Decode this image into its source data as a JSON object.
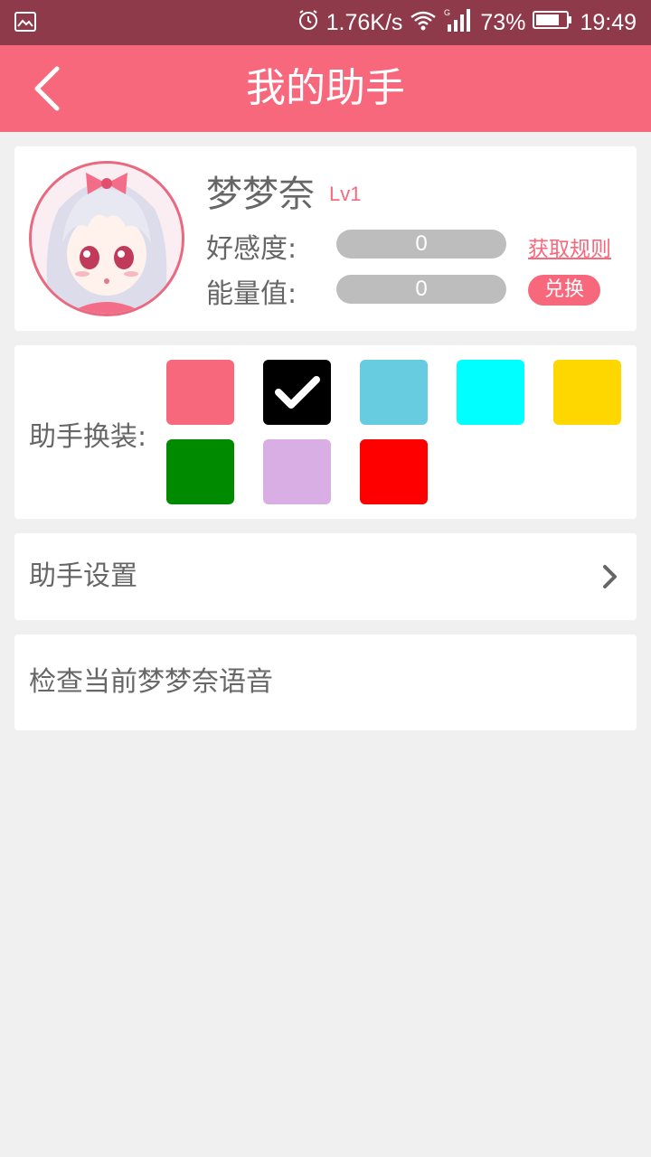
{
  "status_bar": {
    "network_speed": "1.76K/s",
    "battery": "73%",
    "time": "19:49",
    "icons": [
      "gallery-icon",
      "alarm-icon",
      "wifi-icon",
      "signal-icon",
      "battery-icon"
    ]
  },
  "app_bar": {
    "title": "我的助手",
    "back_icon": "chevron-left-icon"
  },
  "profile": {
    "name": "梦梦奈",
    "level": "Lv1",
    "favor_label": "好感度:",
    "favor_value": "0",
    "energy_label": "能量值:",
    "energy_value": "0",
    "rule_link": "获取规则",
    "exchange_button": "兑换"
  },
  "outfit": {
    "label": "助手换装:",
    "colors": [
      "#f8687c",
      "#000000",
      "#67cce0",
      "#00ffff",
      "#ffd700",
      "#008a00",
      "#d9aee4",
      "#ff0000"
    ],
    "selected_index": 1
  },
  "settings_row": {
    "label": "助手设置",
    "chevron_icon": "chevron-right-icon"
  },
  "voice_row": {
    "label": "检查当前梦梦奈语音"
  },
  "theme": {
    "accent": "#f8687c",
    "status_bar_bg": "#8f3a4a",
    "page_bg": "#f0f0f0"
  }
}
